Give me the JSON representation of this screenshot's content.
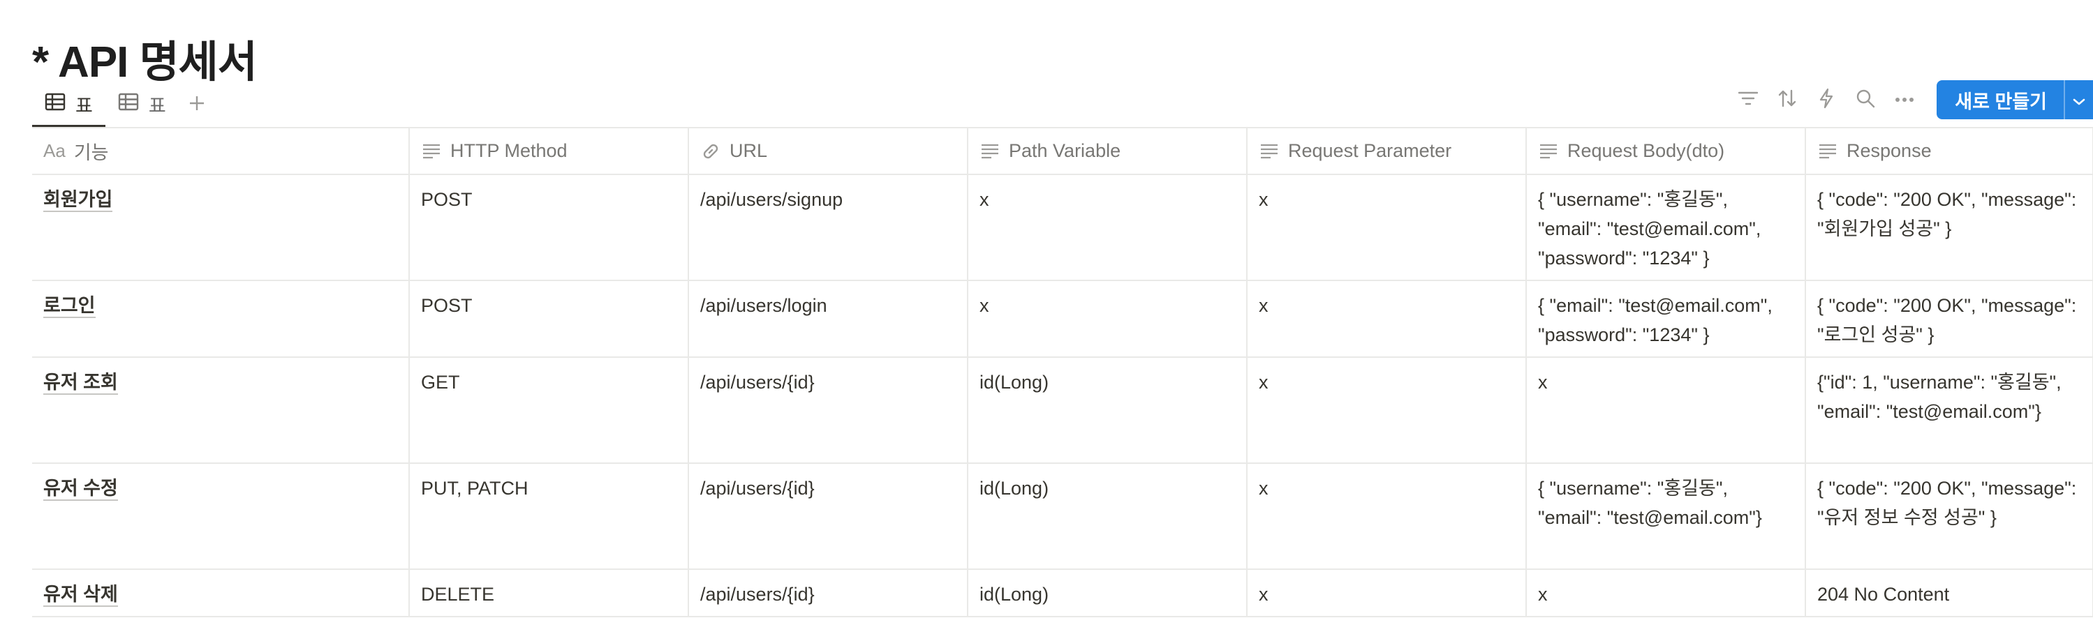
{
  "page": {
    "title": "* API 명세서"
  },
  "views": {
    "tabs": [
      {
        "label": "표",
        "icon": "table-icon",
        "active": true
      },
      {
        "label": "표",
        "icon": "table-icon",
        "active": false
      }
    ],
    "add_icon": "plus-icon"
  },
  "toolbar": {
    "icons": [
      "filter-icon",
      "sort-icon",
      "lightning-icon",
      "search-icon",
      "more-icon"
    ],
    "new_button_label": "새로 만들기",
    "accent_color": "#2383e2"
  },
  "table": {
    "columns": [
      {
        "label": "기능",
        "icon": "aa-title-icon",
        "icon_text": "Aa"
      },
      {
        "label": "HTTP Method",
        "icon": "text-lines-icon"
      },
      {
        "label": "URL",
        "icon": "link-icon"
      },
      {
        "label": "Path Variable",
        "icon": "text-lines-icon"
      },
      {
        "label": "Request Parameter",
        "icon": "text-lines-icon"
      },
      {
        "label": "Request Body(dto)",
        "icon": "text-lines-icon"
      },
      {
        "label": "Response",
        "icon": "text-lines-icon"
      }
    ],
    "rows": [
      {
        "cells": [
          "회원가입",
          "POST",
          "/api/users/signup",
          "x",
          "x",
          "{ \"username\": \"홍길동\", \"email\": \"test@email.com\", \"password\": \"1234\" }",
          "{ \"code\": \"200 OK\", \"message\": \"회원가입 성공\" }"
        ]
      },
      {
        "cells": [
          "로그인",
          "POST",
          "/api/users/login",
          "x",
          "x",
          "{ \"email\": \"test@email.com\", \"password\": \"1234\" }",
          "{ \"code\": \"200 OK\", \"message\": \"로그인 성공\" }"
        ]
      },
      {
        "cells": [
          "유저 조회",
          "GET",
          "/api/users/{id}",
          "id(Long)",
          "x",
          "x",
          "{\"id\": 1, \"username\": \"홍길동\", \"email\": \"test@email.com\"}"
        ]
      },
      {
        "cells": [
          "유저 수정",
          "PUT, PATCH",
          "/api/users/{id}",
          "id(Long)",
          "x",
          "{ \"username\": \"홍길동\", \"email\": \"test@email.com\"}",
          "{ \"code\": \"200 OK\", \"message\": \"유저 정보 수정 성공\" }"
        ]
      },
      {
        "cells": [
          "유저 삭제",
          "DELETE",
          "/api/users/{id}",
          "id(Long)",
          "x",
          "x",
          "204 No Content"
        ]
      }
    ]
  }
}
